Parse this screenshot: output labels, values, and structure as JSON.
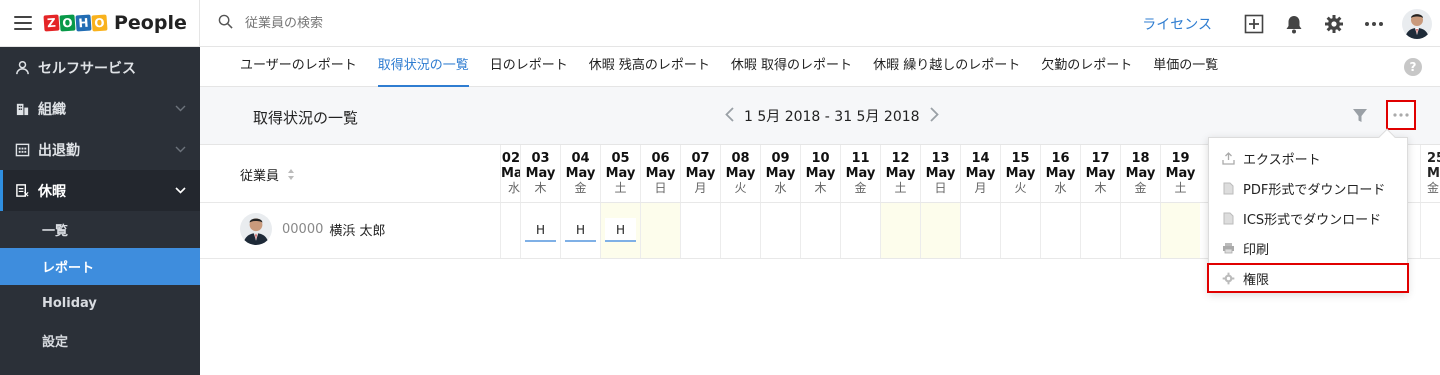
{
  "brand": {
    "logo_letters": [
      "Z",
      "O",
      "H",
      "O"
    ],
    "logo_colors": [
      "#e42527",
      "#089949",
      "#226db4",
      "#f9b21d"
    ],
    "name": "People"
  },
  "sidebar": {
    "items": [
      {
        "label": "セルフサービス",
        "icon": "person-icon"
      },
      {
        "label": "組織",
        "icon": "building-icon",
        "chevron": "⌄"
      },
      {
        "label": "出退勤",
        "icon": "calendar-icon",
        "chevron": "⌄"
      },
      {
        "label": "休暇",
        "icon": "leave-icon",
        "chevron": "⌄",
        "active": true
      }
    ],
    "subitems": [
      "一覧",
      "レポート",
      "Holiday",
      "設定"
    ],
    "selected_subitem": "レポート"
  },
  "topbar": {
    "search_placeholder": "従業員の検索",
    "license_label": "ライセンス"
  },
  "tabs": [
    "ユーザーのレポート",
    "取得状況の一覧",
    "日のレポート",
    "休暇 残高のレポート",
    "休暇 取得のレポート",
    "休暇 繰り越しのレポート",
    "欠勤のレポート",
    "単価の一覧"
  ],
  "active_tab": "取得状況の一覧",
  "subheader": {
    "title": "取得状況の一覧",
    "date_range": "1 5月 2018 - 31 5月 2018"
  },
  "grid": {
    "employee_header": "従業員",
    "days": [
      {
        "num": "02",
        "mon": "May",
        "dow": "水",
        "weekend": false
      },
      {
        "num": "03",
        "mon": "May",
        "dow": "木",
        "weekend": false,
        "mark": "H"
      },
      {
        "num": "04",
        "mon": "May",
        "dow": "金",
        "weekend": false,
        "mark": "H"
      },
      {
        "num": "05",
        "mon": "May",
        "dow": "土",
        "weekend": true,
        "mark": "H"
      },
      {
        "num": "06",
        "mon": "May",
        "dow": "日",
        "weekend": true
      },
      {
        "num": "07",
        "mon": "May",
        "dow": "月",
        "weekend": false
      },
      {
        "num": "08",
        "mon": "May",
        "dow": "火",
        "weekend": false
      },
      {
        "num": "09",
        "mon": "May",
        "dow": "水",
        "weekend": false
      },
      {
        "num": "10",
        "mon": "May",
        "dow": "木",
        "weekend": false
      },
      {
        "num": "11",
        "mon": "May",
        "dow": "金",
        "weekend": false
      },
      {
        "num": "12",
        "mon": "May",
        "dow": "土",
        "weekend": true
      },
      {
        "num": "13",
        "mon": "May",
        "dow": "日",
        "weekend": true
      },
      {
        "num": "14",
        "mon": "May",
        "dow": "月",
        "weekend": false
      },
      {
        "num": "15",
        "mon": "May",
        "dow": "火",
        "weekend": false
      },
      {
        "num": "16",
        "mon": "May",
        "dow": "水",
        "weekend": false
      },
      {
        "num": "17",
        "mon": "May",
        "dow": "木",
        "weekend": false
      },
      {
        "num": "18",
        "mon": "May",
        "dow": "金",
        "weekend": false
      },
      {
        "num": "19",
        "mon": "May",
        "dow": "土",
        "weekend": true
      }
    ],
    "last_day": {
      "num": "25",
      "mon": "May",
      "dow": "金"
    },
    "employee": {
      "id": "00000",
      "name": "横浜 太郎"
    }
  },
  "dropdown": {
    "items": [
      {
        "label": "エクスポート",
        "icon": "export-icon"
      },
      {
        "label": "PDF形式でダウンロード",
        "icon": "file-icon"
      },
      {
        "label": "ICS形式でダウンロード",
        "icon": "file-icon"
      },
      {
        "label": "印刷",
        "icon": "printer-icon"
      },
      {
        "label": "権限",
        "icon": "gear-icon",
        "highlighted": true
      }
    ]
  },
  "colors": {
    "accent": "#2f7dd1",
    "sidebar_bg": "#2b3038",
    "selected_bg": "#3e8ddd",
    "highlight_border": "#e00000",
    "weekend_bg": "#fdfdec"
  }
}
